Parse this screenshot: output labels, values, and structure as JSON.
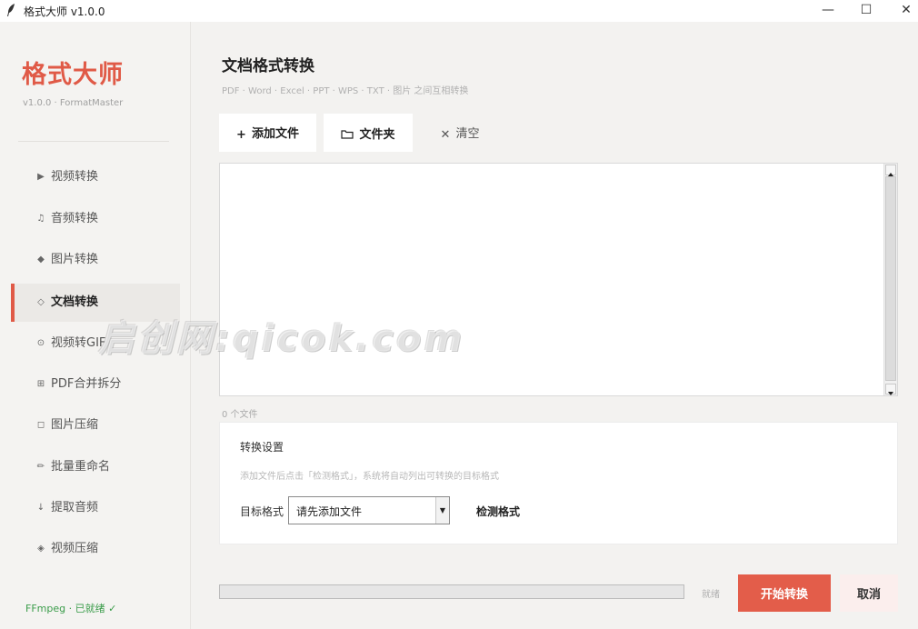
{
  "window": {
    "title": "格式大师 v1.0.0",
    "minimize": "—",
    "maximize": "☐",
    "close": "✕"
  },
  "sidebar": {
    "brand": "格式大师",
    "version": "v1.0.0 · FormatMaster",
    "items": [
      {
        "icon": "▶",
        "label": "视频转换"
      },
      {
        "icon": "♫",
        "label": "音频转换"
      },
      {
        "icon": "◆",
        "label": "图片转换"
      },
      {
        "icon": "◇",
        "label": "文档转换",
        "active": true
      },
      {
        "icon": "⊙",
        "label": "视频转GIF"
      },
      {
        "icon": "⊞",
        "label": "PDF合并拆分"
      },
      {
        "icon": "◻",
        "label": "图片压缩"
      },
      {
        "icon": "✏",
        "label": "批量重命名"
      },
      {
        "icon": "↓",
        "label": "提取音频"
      },
      {
        "icon": "◈",
        "label": "视频压缩"
      }
    ],
    "ffmpeg_status": "FFmpeg · 已就绪 ✓"
  },
  "main": {
    "title": "文档格式转换",
    "subtitle": "PDF · Word · Excel · PPT · WPS · TXT · 图片 之间互相转换",
    "toolbar": {
      "add_files_icon": "+",
      "add_files": "添加文件",
      "folder_label": "文件夹",
      "clear_icon": "✕",
      "clear": "清空"
    },
    "file_count": "0 个文件",
    "settings": {
      "title": "转换设置",
      "hint": "添加文件后点击「检测格式」，系统将自动列出可转换的目标格式",
      "target_label": "目标格式",
      "target_value": "请先添加文件",
      "detect": "检测格式"
    },
    "progress": 0,
    "status": "就绪",
    "start": "开始转换",
    "cancel": "取消"
  },
  "watermark": "启创网:qicok.com",
  "colors": {
    "accent": "#e05a47",
    "ok": "#3a9c4a"
  }
}
